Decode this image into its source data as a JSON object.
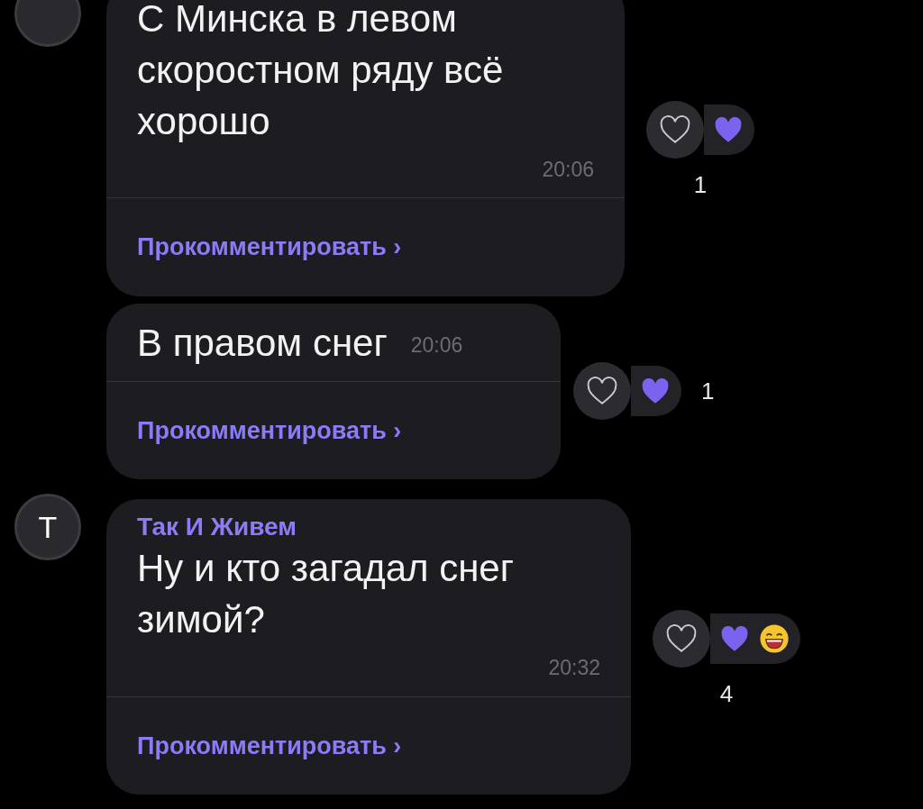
{
  "messages": [
    {
      "kind": "wrapped",
      "avatar": {
        "shown": true
      },
      "text_lines": [
        "С Минска в левом",
        "скоростном ряду всё",
        "хорошо"
      ],
      "time": "20:06",
      "comment_link": "Прокомментировать ›",
      "reactions": {
        "items": [
          {
            "kind": "heart"
          }
        ],
        "count": "1",
        "kind": "stacked"
      }
    },
    {
      "kind": "inline",
      "avatar": {
        "shown": false
      },
      "text_lines": [
        "В правом снег"
      ],
      "time": "20:06",
      "comment_link": "Прокомментировать ›",
      "reactions": {
        "items": [
          {
            "kind": "heart"
          }
        ],
        "count": "1",
        "kind": "inline"
      }
    },
    {
      "kind": "wrapped",
      "avatar": {
        "shown": true,
        "letter": "Т"
      },
      "author": "Так И Живем",
      "text_lines": [
        "Ну и кто загадал снег",
        "зимой?"
      ],
      "time": "20:32",
      "comment_link": "Прокомментировать ›",
      "reactions": {
        "items": [
          {
            "kind": "heart"
          },
          {
            "kind": "laugh"
          }
        ],
        "count": "4",
        "kind": "stacked"
      }
    }
  ]
}
